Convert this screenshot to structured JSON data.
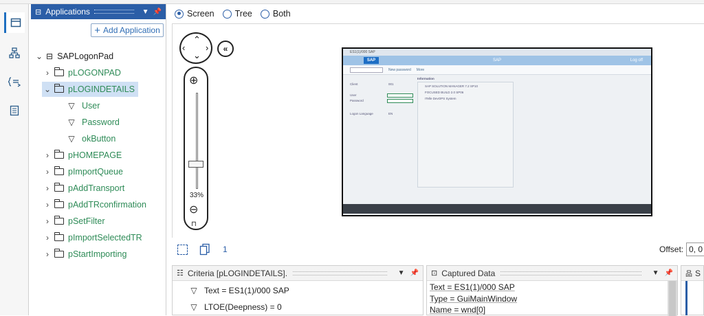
{
  "applications_panel": {
    "title": "Applications",
    "add_label": "Add Application"
  },
  "tree": {
    "root": "SAPLogonPad",
    "items": [
      {
        "label": "pLOGONPAD"
      },
      {
        "label": "pLOGINDETAILS",
        "expanded": true,
        "selected": true,
        "children": [
          "User",
          "Password",
          "okButton"
        ]
      },
      {
        "label": "pHOMEPAGE"
      },
      {
        "label": "pImportQueue"
      },
      {
        "label": "pAddTransport"
      },
      {
        "label": "pAddTRconfirmation"
      },
      {
        "label": "pSetFilter"
      },
      {
        "label": "pImportSelectedTR"
      },
      {
        "label": "pStartImporting"
      }
    ]
  },
  "view_modes": {
    "options": [
      "Screen",
      "Tree",
      "Both"
    ],
    "selected": "Screen"
  },
  "zoom": {
    "level": "33%"
  },
  "preview_sap": {
    "title": "ES1(1)/000 SAP",
    "banner": "SAP",
    "logo": "SAP",
    "toolbar": [
      "New password",
      "More"
    ],
    "logoff": "Log off",
    "client_label": "Client",
    "client_value": "001",
    "user_label": "User",
    "password_label": "Password",
    "language_label": "Logon Language",
    "language_value": "EN",
    "info_title": "Information",
    "info_items": [
      "SAP SOLUTION MANAGER 7.2 SP10",
      "FOCUSED BUILD 2.0 SP06",
      "ITelle DevOPS System"
    ]
  },
  "bottom_toolbar": {
    "count": "1",
    "offset_label": "Offset:",
    "offset_value": "0, 0"
  },
  "criteria": {
    "title": "Criteria [pLOGINDETAILS].",
    "rows": [
      "Text = ES1(1)/000 SAP",
      "LTOE(Deepness) = 0"
    ]
  },
  "captured": {
    "title": "Captured Data",
    "lines": [
      "Text = ES1(1)/000 SAP",
      "Type = GuiMainWindow",
      "Name = wnd[0]"
    ]
  },
  "right_panel": {
    "title": "S"
  },
  "colors": {
    "accent": "#2b5ea7",
    "tree_text": "#2e8b57",
    "selection": "#cfe0f4"
  }
}
